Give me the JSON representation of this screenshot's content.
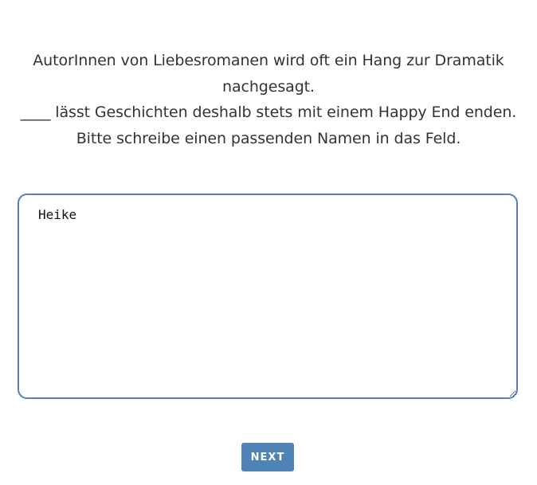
{
  "prompt": {
    "lines": [
      "AutorInnen von Liebesromanen wird oft ein Hang zur Dramatik",
      "nachgesagt.",
      "____ lässt Geschichten deshalb stets mit einem Happy End enden.",
      "Bitte schreibe einen passenden Namen in das Feld."
    ]
  },
  "answer": {
    "value": "Heike"
  },
  "next_button": {
    "label": "NEXT"
  },
  "colors": {
    "accent": "#4f82b5",
    "text": "#333333",
    "background": "#ffffff"
  }
}
